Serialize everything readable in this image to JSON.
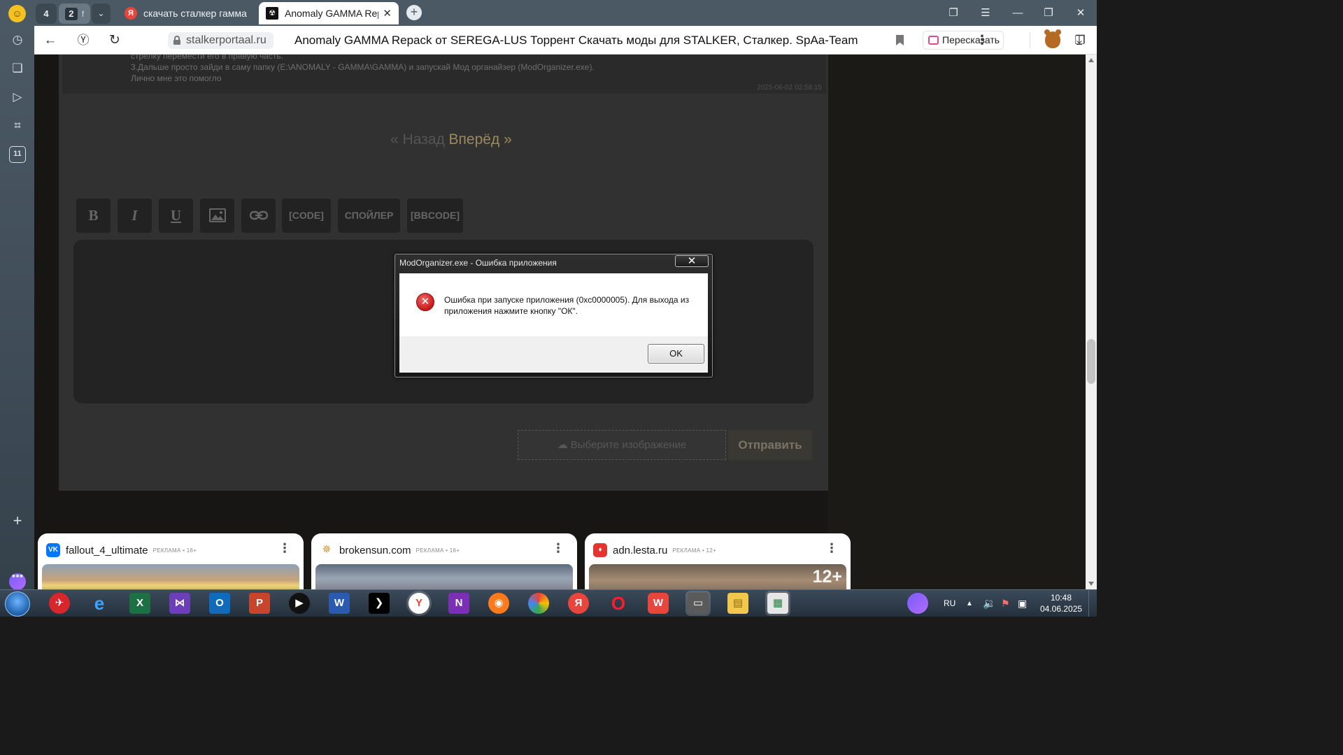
{
  "browser": {
    "tab_groups": [
      {
        "count": "4"
      },
      {
        "count": "2",
        "letter": "f"
      }
    ],
    "tabs": [
      {
        "title": "скачать сталкер гамма ге",
        "icon": "yandex-icon"
      },
      {
        "title": "Anomaly GAMMA Repack",
        "icon": "radiation-icon",
        "active": true
      }
    ],
    "address": {
      "domain": "stalkerportaal.ru",
      "title": "Anomaly GAMMA Repack от SEREGA-LUS Торрент Скачать моды для STALKER, Сталкер. SpAa-Team"
    },
    "retell_label": "Пересказать",
    "sidebar_badge": "11"
  },
  "page": {
    "comment": {
      "lines": [
        "стрелку перемести его в правую часть.",
        "3.Дальше просто зайди в саму папку (E:\\ANOMALY - GAMMA\\GAMMA) и запускай Мод органайзер (ModOrganizer.exe).",
        "Лично мне это помогло"
      ],
      "date": "2025-06-02 02:58:15"
    },
    "pager": {
      "prev_quote": "«",
      "prev": "Назад",
      "next": "Вперёд",
      "next_quote": "»"
    },
    "toolbar": {
      "bold": "B",
      "italic": "I",
      "underline": "U",
      "code": "[CODE]",
      "spoiler": "СПОЙЛЕР",
      "bbcode": "[BBCODE]"
    },
    "choose_image": "Выберите изображение",
    "send": "Отправить"
  },
  "ads": [
    {
      "name": "fallout_4_ultimate",
      "mark": "РЕКЛАМА • 16+",
      "logo_color": "#0077ff",
      "logo": "vk-icon"
    },
    {
      "name": "brokensun.com",
      "mark": "РЕКЛАМА • 16+",
      "logo_color": "#ffffff",
      "logo": "star-icon"
    },
    {
      "name": "adn.lesta.ru",
      "mark": "РЕКЛАМА • 12+",
      "logo_color": "#e3342f",
      "logo": "lesta-icon",
      "age_badge": "12+"
    }
  ],
  "dialog": {
    "title": "ModOrganizer.exe - Ошибка приложения",
    "message": "Ошибка при запуске приложения (0xc0000005). Для выхода из приложения нажмите кнопку \"ОК\".",
    "ok": "OK",
    "close": "✕"
  },
  "taskbar": {
    "lang": "RU",
    "time": "10:48",
    "date": "04.06.2025"
  }
}
